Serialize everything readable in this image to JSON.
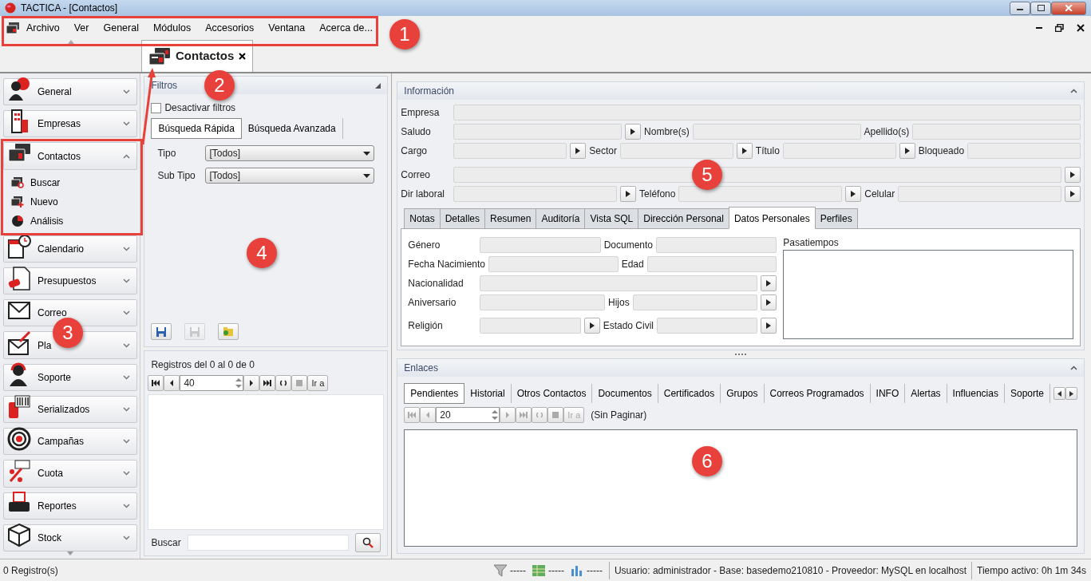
{
  "window": {
    "title": "TACTICA - [Contactos]"
  },
  "menu": {
    "items": [
      "Archivo",
      "Ver",
      "General",
      "Módulos",
      "Accesorios",
      "Ventana",
      "Acerca de..."
    ]
  },
  "document_tabs": [
    {
      "label": "Contactos",
      "selected": true
    }
  ],
  "sidebar": {
    "items": [
      {
        "label": "General",
        "expanded": false
      },
      {
        "label": "Empresas",
        "expanded": false
      },
      {
        "label": "Contactos",
        "expanded": true,
        "children": [
          {
            "label": "Buscar"
          },
          {
            "label": "Nuevo"
          },
          {
            "label": "Análisis"
          }
        ]
      },
      {
        "label": "Calendario",
        "expanded": false
      },
      {
        "label": "Presupuestos",
        "expanded": false
      },
      {
        "label": "Correo",
        "expanded": false
      },
      {
        "label": "Pla",
        "expanded": false
      },
      {
        "label": "Soporte",
        "expanded": false
      },
      {
        "label": "Serializados",
        "expanded": false
      },
      {
        "label": "Campañas",
        "expanded": false
      },
      {
        "label": "Cuota",
        "expanded": false
      },
      {
        "label": "Reportes",
        "expanded": false
      },
      {
        "label": "Stock",
        "expanded": false
      }
    ]
  },
  "filters": {
    "title": "Filtros",
    "disable_filters": {
      "label": "Desactivar filtros",
      "checked": false
    },
    "tabs": [
      {
        "label": "Búsqueda Rápida",
        "selected": true
      },
      {
        "label": "Búsqueda Avanzada",
        "selected": false
      }
    ],
    "fields": [
      {
        "label": "Tipo",
        "value": "[Todos]"
      },
      {
        "label": "Sub Tipo",
        "value": "[Todos]"
      }
    ],
    "buttons": [
      {
        "disabled": false
      },
      {
        "disabled": true
      },
      {
        "disabled": false
      }
    ]
  },
  "results": {
    "summary": "Registros del 0 al 0 de 0",
    "page_size": "40",
    "go_label": "Ir a",
    "search_label": "Buscar"
  },
  "information": {
    "title": "Información",
    "rows": [
      [
        {
          "label": "Empresa",
          "kind": "text"
        }
      ],
      [
        {
          "label": "Saludo",
          "kind": "lookup"
        },
        {
          "label": "Nombre(s)",
          "kind": "text"
        },
        {
          "label": "Apellido(s)",
          "kind": "text"
        }
      ],
      [
        {
          "label": "Cargo",
          "kind": "lookup"
        },
        {
          "label": "Sector",
          "kind": "lookup"
        },
        {
          "label": "Título",
          "kind": "lookup"
        },
        {
          "label": "Bloqueado",
          "kind": "text"
        }
      ],
      [
        {
          "label": "Correo",
          "kind": "lookup"
        }
      ],
      [
        {
          "label": "Dir laboral",
          "kind": "lookup"
        },
        {
          "label": "Teléfono",
          "kind": "lookup"
        },
        {
          "label": "Celular",
          "kind": "lookup"
        }
      ]
    ]
  },
  "detail_tabs": [
    {
      "label": "Notas",
      "selected": false
    },
    {
      "label": "Detalles",
      "selected": false
    },
    {
      "label": "Resumen",
      "selected": false
    },
    {
      "label": "Auditoría",
      "selected": false
    },
    {
      "label": "Vista SQL",
      "selected": false
    },
    {
      "label": "Dirección Personal",
      "selected": false
    },
    {
      "label": "Datos Personales",
      "selected": true
    },
    {
      "label": "Perfiles",
      "selected": false
    }
  ],
  "personal": {
    "rows": [
      [
        {
          "label": "Género",
          "kind": "text"
        },
        {
          "label": "Documento",
          "kind": "text"
        }
      ],
      [
        {
          "label": "Fecha Nacimiento",
          "kind": "text"
        },
        {
          "label": "Edad",
          "kind": "text"
        }
      ],
      [
        {
          "label": "Nacionalidad",
          "kind": "lookup"
        }
      ],
      [
        {
          "label": "Aniversario",
          "kind": "text"
        },
        {
          "label": "Hijos",
          "kind": "lookup"
        }
      ],
      [
        {
          "label": "Religión",
          "kind": "lookup"
        },
        {
          "label": "Estado Civil",
          "kind": "lookup"
        }
      ]
    ],
    "hobbies_label": "Pasatiempos"
  },
  "links": {
    "title": "Enlaces",
    "tabs": [
      {
        "label": "Pendientes",
        "selected": true
      },
      {
        "label": "Historial",
        "selected": false
      },
      {
        "label": "Otros Contactos",
        "selected": false
      },
      {
        "label": "Documentos",
        "selected": false
      },
      {
        "label": "Certificados",
        "selected": false
      },
      {
        "label": "Grupos",
        "selected": false
      },
      {
        "label": "Correos Programados",
        "selected": false
      },
      {
        "label": "INFO",
        "selected": false
      },
      {
        "label": "Alertas",
        "selected": false
      },
      {
        "label": "Influencias",
        "selected": false
      },
      {
        "label": "Soporte",
        "selected": false
      }
    ],
    "pager": {
      "page_size": "20",
      "go_label": "Ir a",
      "disabled": true,
      "note": "(Sin Paginar)"
    }
  },
  "status_bar": {
    "records": "0 Registro(s)",
    "indicators": [
      "-----",
      "-----",
      "-----"
    ],
    "session": "Usuario: administrador - Base: basedemo210810 - Proveedor: MySQL en localhost",
    "uptime": "Tiempo activo: 0h 1m 34s"
  },
  "callouts": [
    {
      "label": "1"
    },
    {
      "label": "2"
    },
    {
      "label": "3"
    },
    {
      "label": "4"
    },
    {
      "label": "5"
    },
    {
      "label": "6"
    }
  ]
}
